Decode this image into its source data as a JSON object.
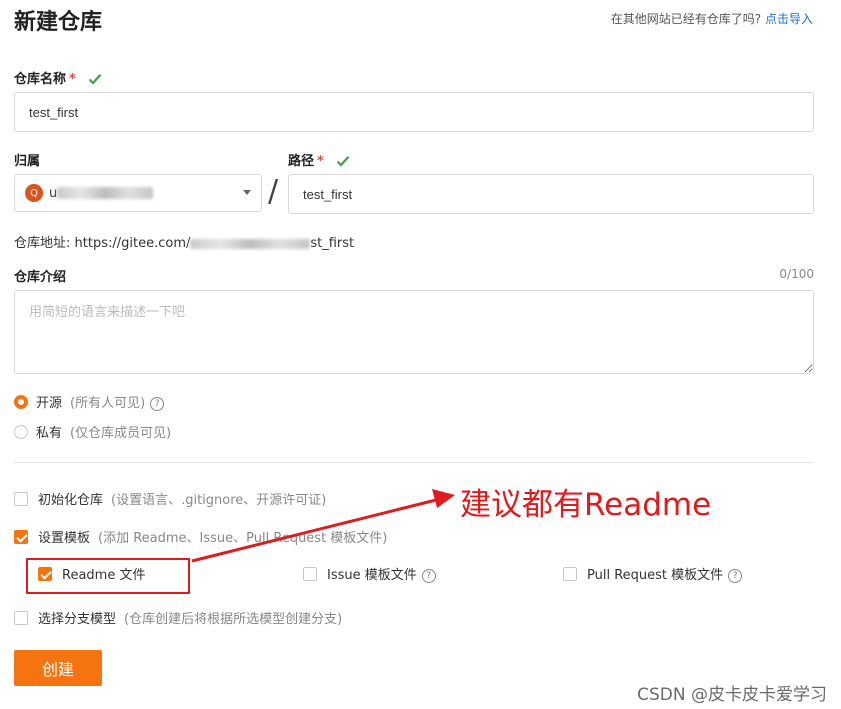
{
  "header": {
    "title": "新建仓库",
    "import_hint": "在其他网站已经有仓库了吗?",
    "import_link": "点击导入"
  },
  "repo_name": {
    "label": "仓库名称",
    "required_mark": "*",
    "value": "test_first"
  },
  "owner": {
    "label": "归属",
    "avatar_letter": "Q",
    "prefix": "u"
  },
  "path": {
    "label": "路径",
    "required_mark": "*",
    "separator": "/",
    "value": "test_first"
  },
  "repo_url": {
    "prefix": "仓库地址:",
    "start": "https://gitee.com/",
    "end": "st_first"
  },
  "description": {
    "label": "仓库介绍",
    "counter": "0/100",
    "placeholder": "用简短的语言来描述一下吧"
  },
  "visibility": {
    "options": [
      {
        "label": "开源",
        "hint": "(所有人可见)",
        "selected": true
      },
      {
        "label": "私有",
        "hint": "(仅仓库成员可见)",
        "selected": false
      }
    ]
  },
  "init_repo": {
    "label": "初始化仓库",
    "hint": "(设置语言、.gitignore、开源许可证)",
    "checked": false
  },
  "templates": {
    "label": "设置模板",
    "hint": "(添加 Readme、Issue、Pull Request 模板文件)",
    "checked": true,
    "readme": {
      "label": "Readme 文件",
      "checked": true
    },
    "issue": {
      "label": "Issue 模板文件",
      "checked": false
    },
    "pull_request": {
      "label": "Pull Request 模板文件",
      "checked": false
    }
  },
  "branch_model": {
    "label": "选择分支模型",
    "hint": "(仓库创建后将根据所选模型创建分支)",
    "checked": false
  },
  "create_button": "创建",
  "annotation": "建议都有Readme",
  "watermark": "CSDN @皮卡皮卡爱学习",
  "colors": {
    "accent": "#f6740f",
    "link": "#1e6fd9",
    "annotation": "#e01b1b",
    "success": "#3ca14b"
  }
}
